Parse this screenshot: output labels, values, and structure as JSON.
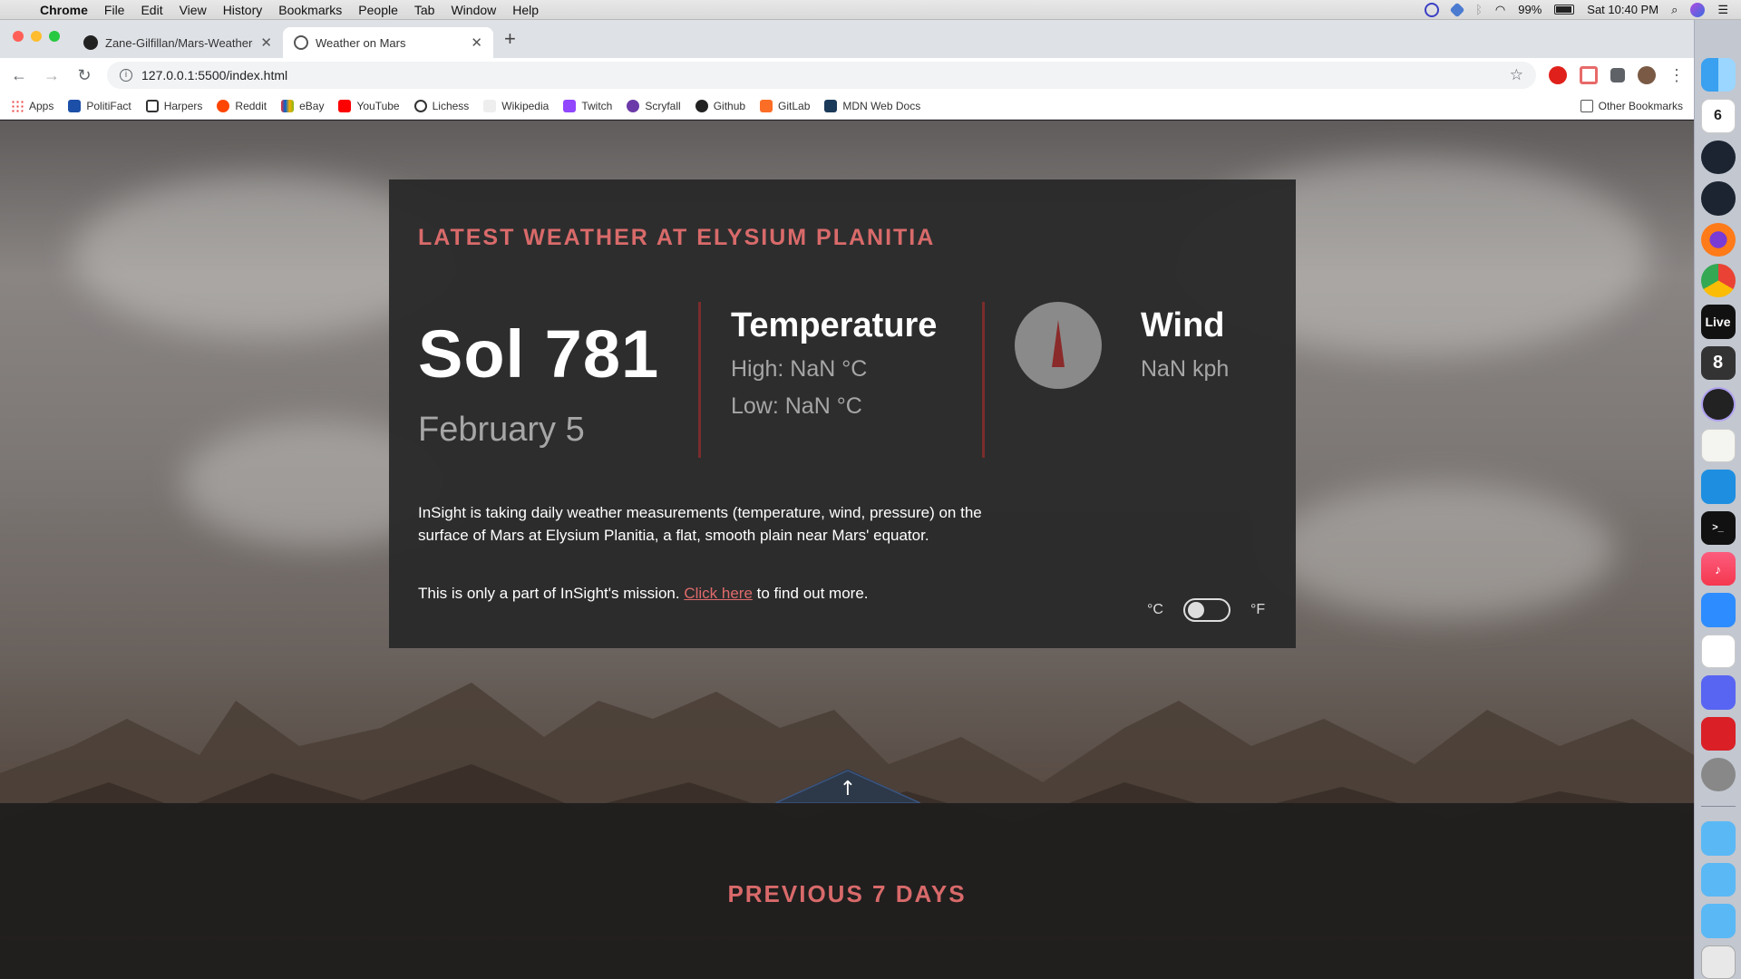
{
  "menubar": {
    "app_name": "Chrome",
    "menus": [
      "File",
      "Edit",
      "View",
      "History",
      "Bookmarks",
      "People",
      "Tab",
      "Window",
      "Help"
    ],
    "battery": "99%",
    "clock": "Sat 10:40 PM"
  },
  "tabs": [
    {
      "title": "Zane-Gilfillan/Mars-Weather-A",
      "icon": "github-icon",
      "active": false
    },
    {
      "title": "Weather on Mars",
      "icon": "globe-icon",
      "active": true
    }
  ],
  "toolbar": {
    "url": "127.0.0.1:5500/index.html"
  },
  "bookmarks": {
    "items": [
      "Apps",
      "PolitiFact",
      "Harpers",
      "Reddit",
      "eBay",
      "YouTube",
      "Lichess",
      "Wikipedia",
      "Twitch",
      "Scryfall",
      "Github",
      "GitLab",
      "MDN Web Docs"
    ],
    "other": "Other Bookmarks"
  },
  "weather": {
    "heading": "Latest Weather at Elysium Planitia",
    "sol": "Sol 781",
    "date": "February 5",
    "temperature": {
      "title": "Temperature",
      "high": "High: NaN °C",
      "low": "Low: NaN °C"
    },
    "wind": {
      "title": "Wind",
      "speed": "NaN kph"
    },
    "description": "InSight is taking daily weather measurements (temperature, wind, pressure) on the surface of Mars at Elysium Planitia, a flat, smooth plain near Mars' equator.",
    "mission_prefix": "This is only a part of InSight's mission.",
    "mission_link": "Click here",
    "mission_suffix": "to find out more.",
    "unit_celsius": "°C",
    "unit_fahrenheit": "°F",
    "unit_toggle_on": false
  },
  "previous": {
    "title": "Previous 7 Days"
  },
  "dock": {
    "calendar_day": "6",
    "live_label": "Live"
  },
  "colors": {
    "accent": "#d96a6a",
    "card_bg": "#2a2a2b",
    "divider": "#7a2c2c",
    "compass": "#8a8a8a",
    "needle": "#8b2a2a"
  }
}
